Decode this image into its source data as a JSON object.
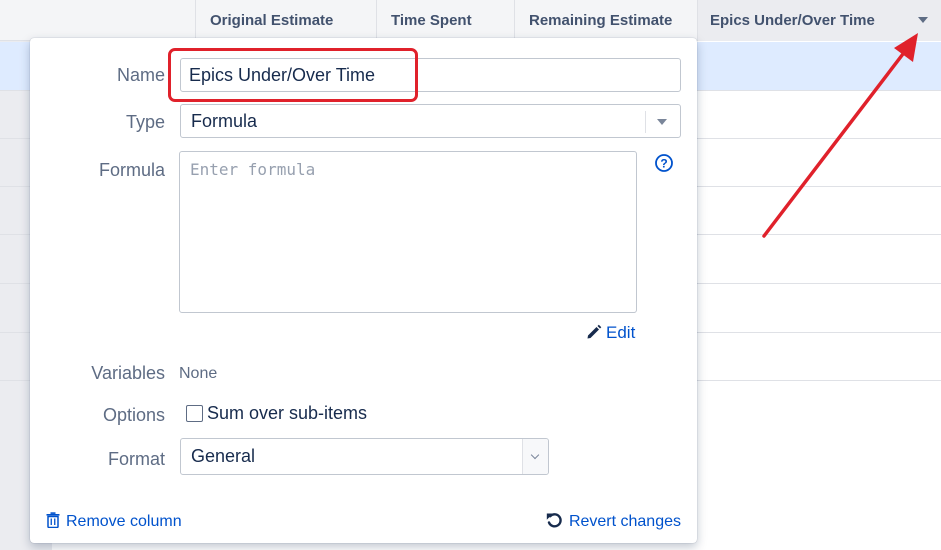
{
  "table": {
    "columns": [
      {
        "label": "Original Estimate"
      },
      {
        "label": "Time Spent"
      },
      {
        "label": "Remaining Estimate"
      },
      {
        "label": "Epics Under/Over Time"
      }
    ]
  },
  "column_editor": {
    "name_label": "Name",
    "name_value": "Epics Under/Over Time",
    "type_label": "Type",
    "type_value": "Formula",
    "formula_label": "Formula",
    "formula_placeholder": "Enter formula",
    "help_icon_glyph": "?",
    "edit_link": "Edit",
    "variables_label": "Variables",
    "variables_value": "None",
    "options_label": "Options",
    "sum_over_subitems_label": "Sum over sub-items",
    "sum_over_subitems_checked": false,
    "format_label": "Format",
    "format_value": "General",
    "remove_column_link": "Remove column",
    "revert_changes_link": "Revert changes"
  },
  "icons": {
    "column_dropdown": "caret-down-icon",
    "help": "question-circle-icon",
    "edit": "pencil-icon",
    "remove": "trash-icon",
    "revert": "undo-icon"
  },
  "colors": {
    "accent_link": "#0052cc",
    "annotation_red": "#e0212b",
    "selected_row": "#deebff"
  }
}
